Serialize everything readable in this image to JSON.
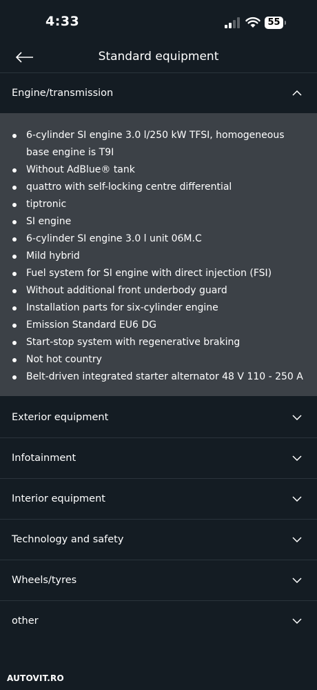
{
  "status_bar": {
    "time": "4:33",
    "battery": "55"
  },
  "header": {
    "title": "Standard equipment"
  },
  "expanded_section": {
    "label": "Engine/transmission",
    "items": [
      "6-cylinder SI engine 3.0 l/250 kW TFSI, homogeneous base engine is T9I",
      "Without AdBlue® tank",
      "quattro with self-locking centre differential",
      "tiptronic",
      "SI engine",
      "6-cylinder SI engine 3.0 l unit 06M.C",
      "Mild hybrid",
      "Fuel system for SI engine with direct injection (FSI)",
      "Without additional front underbody guard",
      "Installation parts for six-cylinder engine",
      "Emission Standard EU6 DG",
      "Start-stop system with regenerative braking",
      "Not hot country",
      "Belt-driven integrated starter alternator 48 V 110 - 250 A"
    ]
  },
  "collapsed_sections": [
    {
      "label": "Exterior equipment"
    },
    {
      "label": "Infotainment"
    },
    {
      "label": "Interior equipment"
    },
    {
      "label": "Technology and safety"
    },
    {
      "label": "Wheels/tyres"
    },
    {
      "label": "other"
    }
  ],
  "watermark": {
    "text": "AUTOVIT.RO"
  },
  "colors": {
    "background": "#141c23",
    "expanded_panel": "#3c4147",
    "divider": "#2b343c",
    "text": "#ffffff"
  }
}
